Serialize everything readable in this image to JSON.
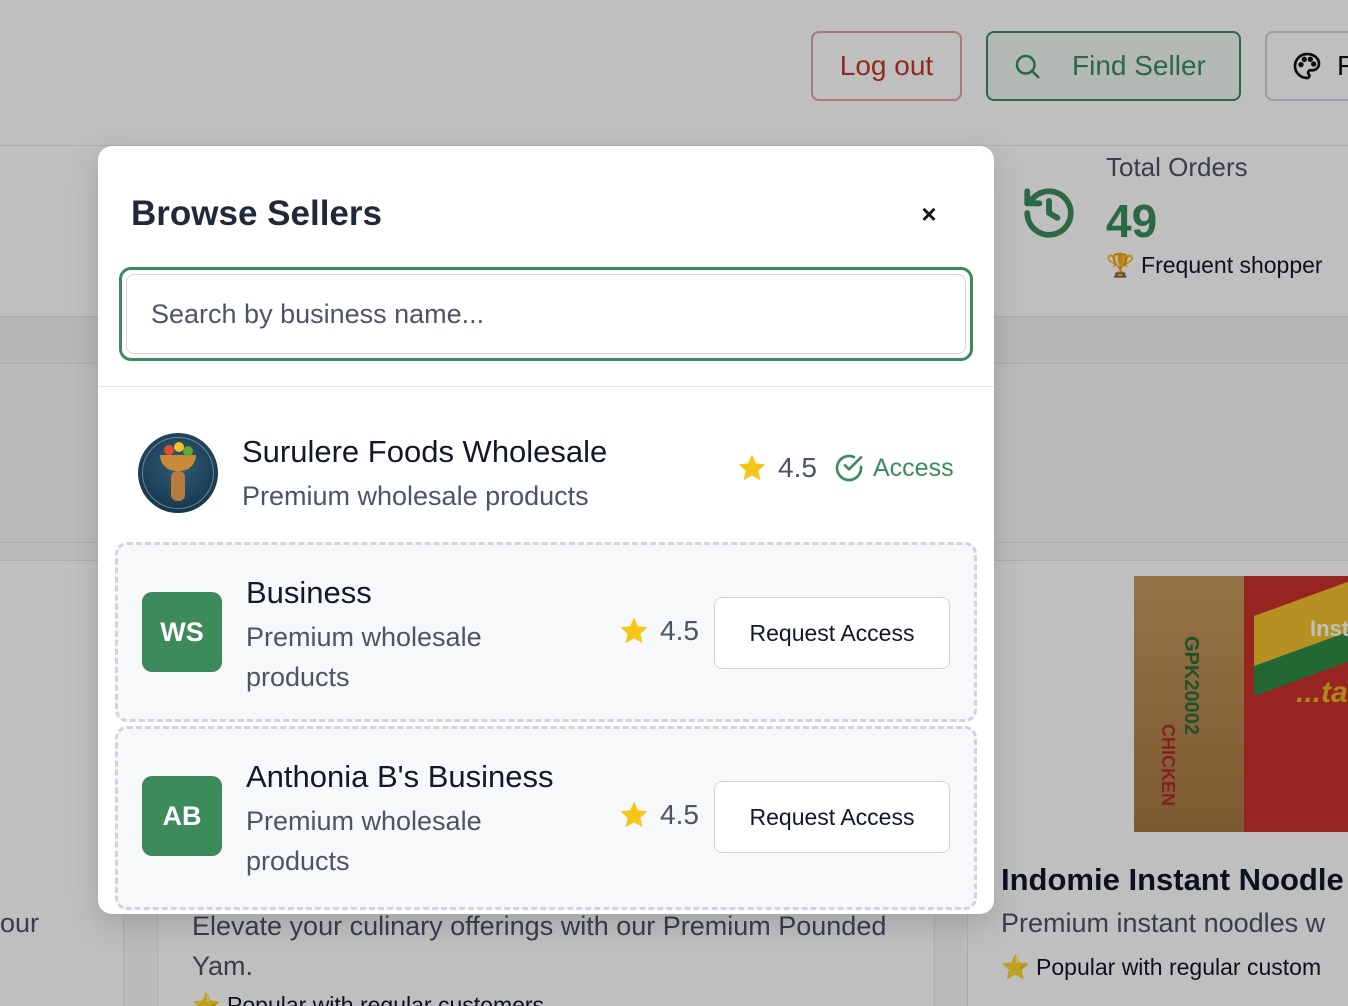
{
  "header": {
    "logout_label": "Log out",
    "find_seller_label": "Find Seller",
    "theme_label": "F"
  },
  "stats": {
    "total_orders_label": "Total Orders",
    "total_orders_value": "49",
    "total_orders_sub": "🏆 Frequent shopper"
  },
  "background": {
    "left_card_fragment": "our",
    "mid_card_desc": "Elevate your culinary offerings with our Premium Pounded Yam.",
    "mid_card_pop": "⭐ Popular with regular customers",
    "right_card_title": "Indomie Instant Noodle",
    "right_card_sub": "Premium instant noodles w",
    "right_card_pop": "⭐ Popular with regular custom",
    "product_img_text_1": "GPK20002",
    "product_img_text_2": "Insta",
    "product_img_text_3": "...ta",
    "product_img_text_4": "CHICKEN"
  },
  "modal": {
    "title": "Browse Sellers",
    "close_label": "×",
    "search_placeholder": "Search by business name...",
    "sellers": [
      {
        "name": "Surulere Foods Wholesale",
        "desc": "Premium wholesale products",
        "rating": "4.5",
        "status": "Access",
        "logo": "surulere-foods-logo"
      },
      {
        "name": "Business",
        "desc": "Premium wholesale products",
        "rating": "4.5",
        "initials": "WS",
        "action": "Request Access"
      },
      {
        "name": "Anthonia B's Business",
        "desc": "Premium wholesale products",
        "rating": "4.5",
        "initials": "AB",
        "action": "Request Access"
      }
    ]
  },
  "colors": {
    "accent": "#3d8b5c",
    "danger": "#c0392b",
    "star": "#f5c518"
  }
}
